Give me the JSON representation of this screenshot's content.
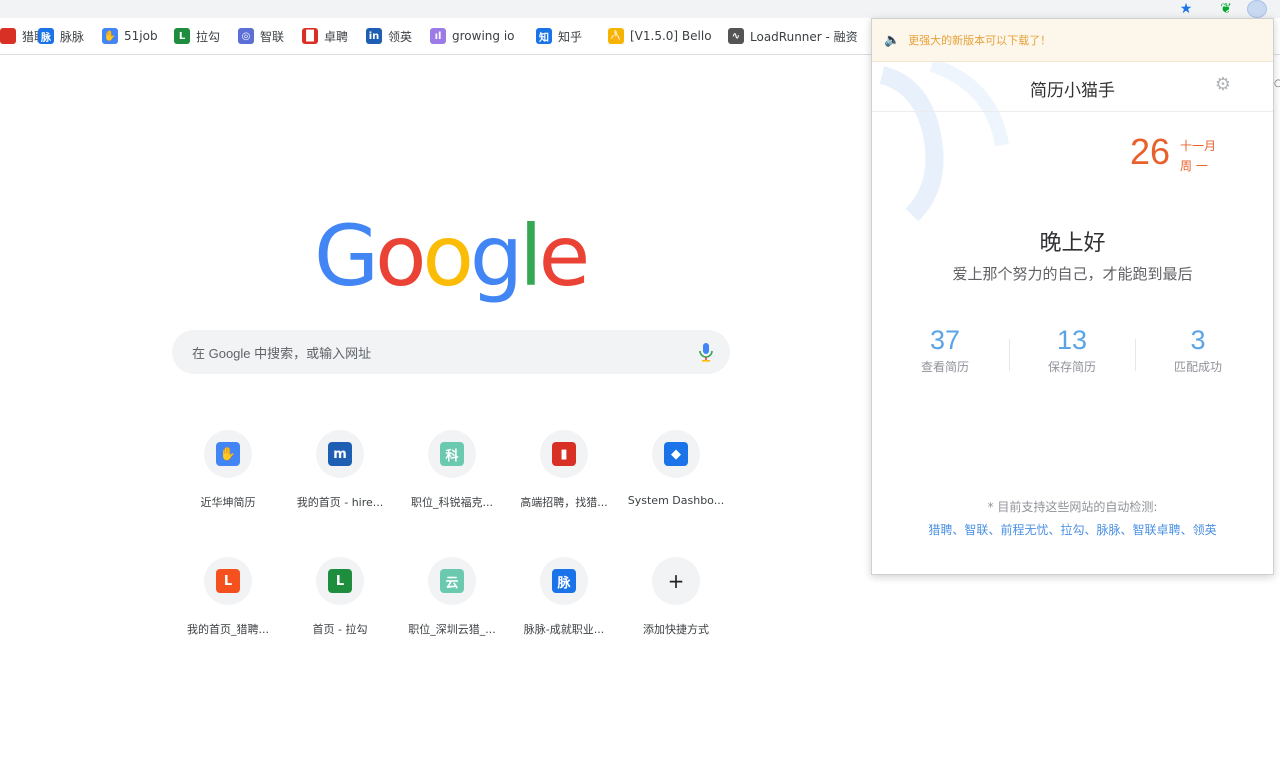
{
  "bookmarks": [
    {
      "label": "猎聘",
      "icon_color": "#d93025",
      "glyph": ""
    },
    {
      "label": "脉脉",
      "icon_color": "#1a73e8",
      "glyph": "脉"
    },
    {
      "label": "51job",
      "icon_color": "#4285f4",
      "glyph": "✋"
    },
    {
      "label": "拉勾",
      "icon_color": "#1e8e3e",
      "glyph": "L"
    },
    {
      "label": "智联",
      "icon_color": "#5b6fd6",
      "glyph": "◎"
    },
    {
      "label": "卓聘",
      "icon_color": "#d93025",
      "glyph": "█"
    },
    {
      "label": "领英",
      "icon_color": "#1e5fb3",
      "glyph": "in"
    },
    {
      "label": "growing io",
      "icon_color": "#9c7be8",
      "glyph": "ıl"
    },
    {
      "label": "知乎",
      "icon_color": "#1a73e8",
      "glyph": "知"
    },
    {
      "label": "[V1.5.0] Bello",
      "icon_color": "#f4b400",
      "glyph": "🍌"
    },
    {
      "label": "LoadRunner - 融资",
      "icon_color": "#555555",
      "glyph": "∿"
    }
  ],
  "google": {
    "logo_letters": [
      "G",
      "o",
      "o",
      "g",
      "l",
      "e"
    ],
    "logo_colors": [
      "#4285f4",
      "#ea4335",
      "#fbbc05",
      "#4285f4",
      "#34a853",
      "#ea4335"
    ],
    "search_placeholder": "在 Google 中搜索，或输入网址"
  },
  "shortcuts": [
    {
      "label": "近华坤简历",
      "color": "#4285f4",
      "glyph": "✋"
    },
    {
      "label": "我的首页 - hire...",
      "color": "#1e5fb3",
      "glyph": "m"
    },
    {
      "label": "职位_科锐福克...",
      "color": "#6bc9b0",
      "glyph": "科"
    },
    {
      "label": "高端招聘，找猎...",
      "color": "#d93025",
      "glyph": "▮"
    },
    {
      "label": "System Dashbo...",
      "color": "#1a73e8",
      "glyph": "◆"
    },
    {
      "label": "我的首页_猎聘...",
      "color": "#f4511e",
      "glyph": "L"
    },
    {
      "label": "首页 - 拉勾",
      "color": "#1e8e3e",
      "glyph": "L"
    },
    {
      "label": "职位_深圳云猎_...",
      "color": "#6bc9b0",
      "glyph": "云"
    },
    {
      "label": "脉脉-成就职业...",
      "color": "#1a73e8",
      "glyph": "脉"
    },
    {
      "label": "添加快捷方式",
      "color": "#202124",
      "glyph": "+"
    }
  ],
  "popup": {
    "notice": "更强大的新版本可以下载了！",
    "title": "简历小猫手",
    "date_day": "26",
    "date_month": "十一月",
    "date_week": "周 一",
    "greeting": "晚上好",
    "motto": "爱上那个努力的自己，才能跑到最后",
    "stats": [
      {
        "value": "37",
        "label": "查看简历"
      },
      {
        "value": "13",
        "label": "保存简历"
      },
      {
        "value": "3",
        "label": "匹配成功"
      }
    ],
    "sites_title": "* 目前支持这些网站的自动检测:",
    "sites": [
      "猎聘",
      "智联",
      "前程无忧",
      "拉勾",
      "脉脉",
      "智联卓聘",
      "领英"
    ],
    "accent": "#e8602c",
    "link_color": "#4a90e2"
  }
}
